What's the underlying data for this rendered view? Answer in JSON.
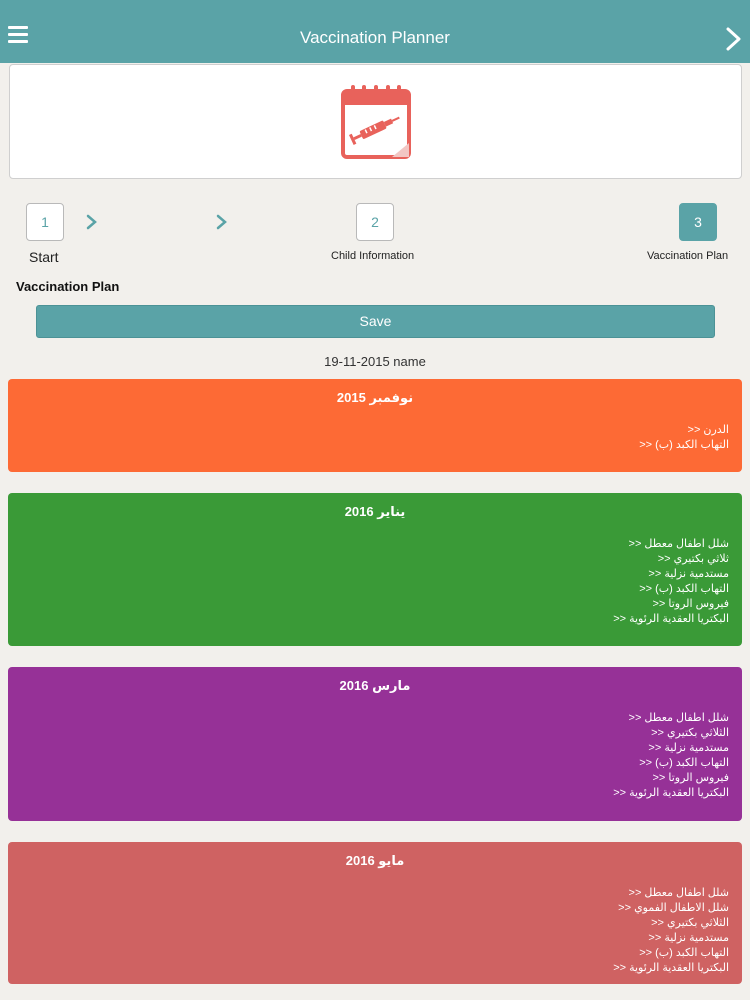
{
  "app": {
    "title": "Vaccination Planner"
  },
  "icons": {
    "menu": "hamburger-menu-icon",
    "next": "chevron-right-icon",
    "header": "calendar-syringe-icon"
  },
  "colors": {
    "accent": "#5aa3a7",
    "header_icon": "#e8625b"
  },
  "steps": [
    {
      "number": "1",
      "label": "Start",
      "active": false
    },
    {
      "number": "2",
      "label": "Child Information",
      "active": false
    },
    {
      "number": "3",
      "label": "Vaccination Plan",
      "active": true
    }
  ],
  "plan": {
    "section_title": "Vaccination Plan",
    "save_label": "Save",
    "subtitle": "19-11-2015 name"
  },
  "months": [
    {
      "title": "نوفمبر 2015",
      "color": "#fd6a35",
      "vaccines": [
        "الدرن  <<",
        "التهاب الكبد (ب)  <<"
      ]
    },
    {
      "title": "يناير 2016",
      "color": "#3a9a37",
      "vaccines": [
        "شلل اطفال معطل  <<",
        "ثلاثي بكتيري  <<",
        "مستدمية نزلية  <<",
        "التهاب الكبد (ب)  <<",
        "فيروس الروتا  <<",
        "البكتريا العقدية الرئوية  <<"
      ]
    },
    {
      "title": "مارس 2016",
      "color": "#963197",
      "vaccines": [
        "شلل اطفال معطل  <<",
        "الثلاثي بكتيري  <<",
        "مستدمية نزلية  <<",
        "التهاب الكبد (ب)  <<",
        "فيروس الروتا  <<",
        "البكتريا العقدية الرئوية  <<"
      ]
    },
    {
      "title": "مايو 2016",
      "color": "#cf6262",
      "vaccines": [
        "شلل اطفال معطل  <<",
        "شلل الاطفال الفموي  <<",
        "الثلاثي بكتيري  <<",
        "مستدمية نزلية  <<",
        "التهاب الكبد (ب)  <<",
        "البكتريا العقدية الرئوية  <<"
      ]
    }
  ]
}
